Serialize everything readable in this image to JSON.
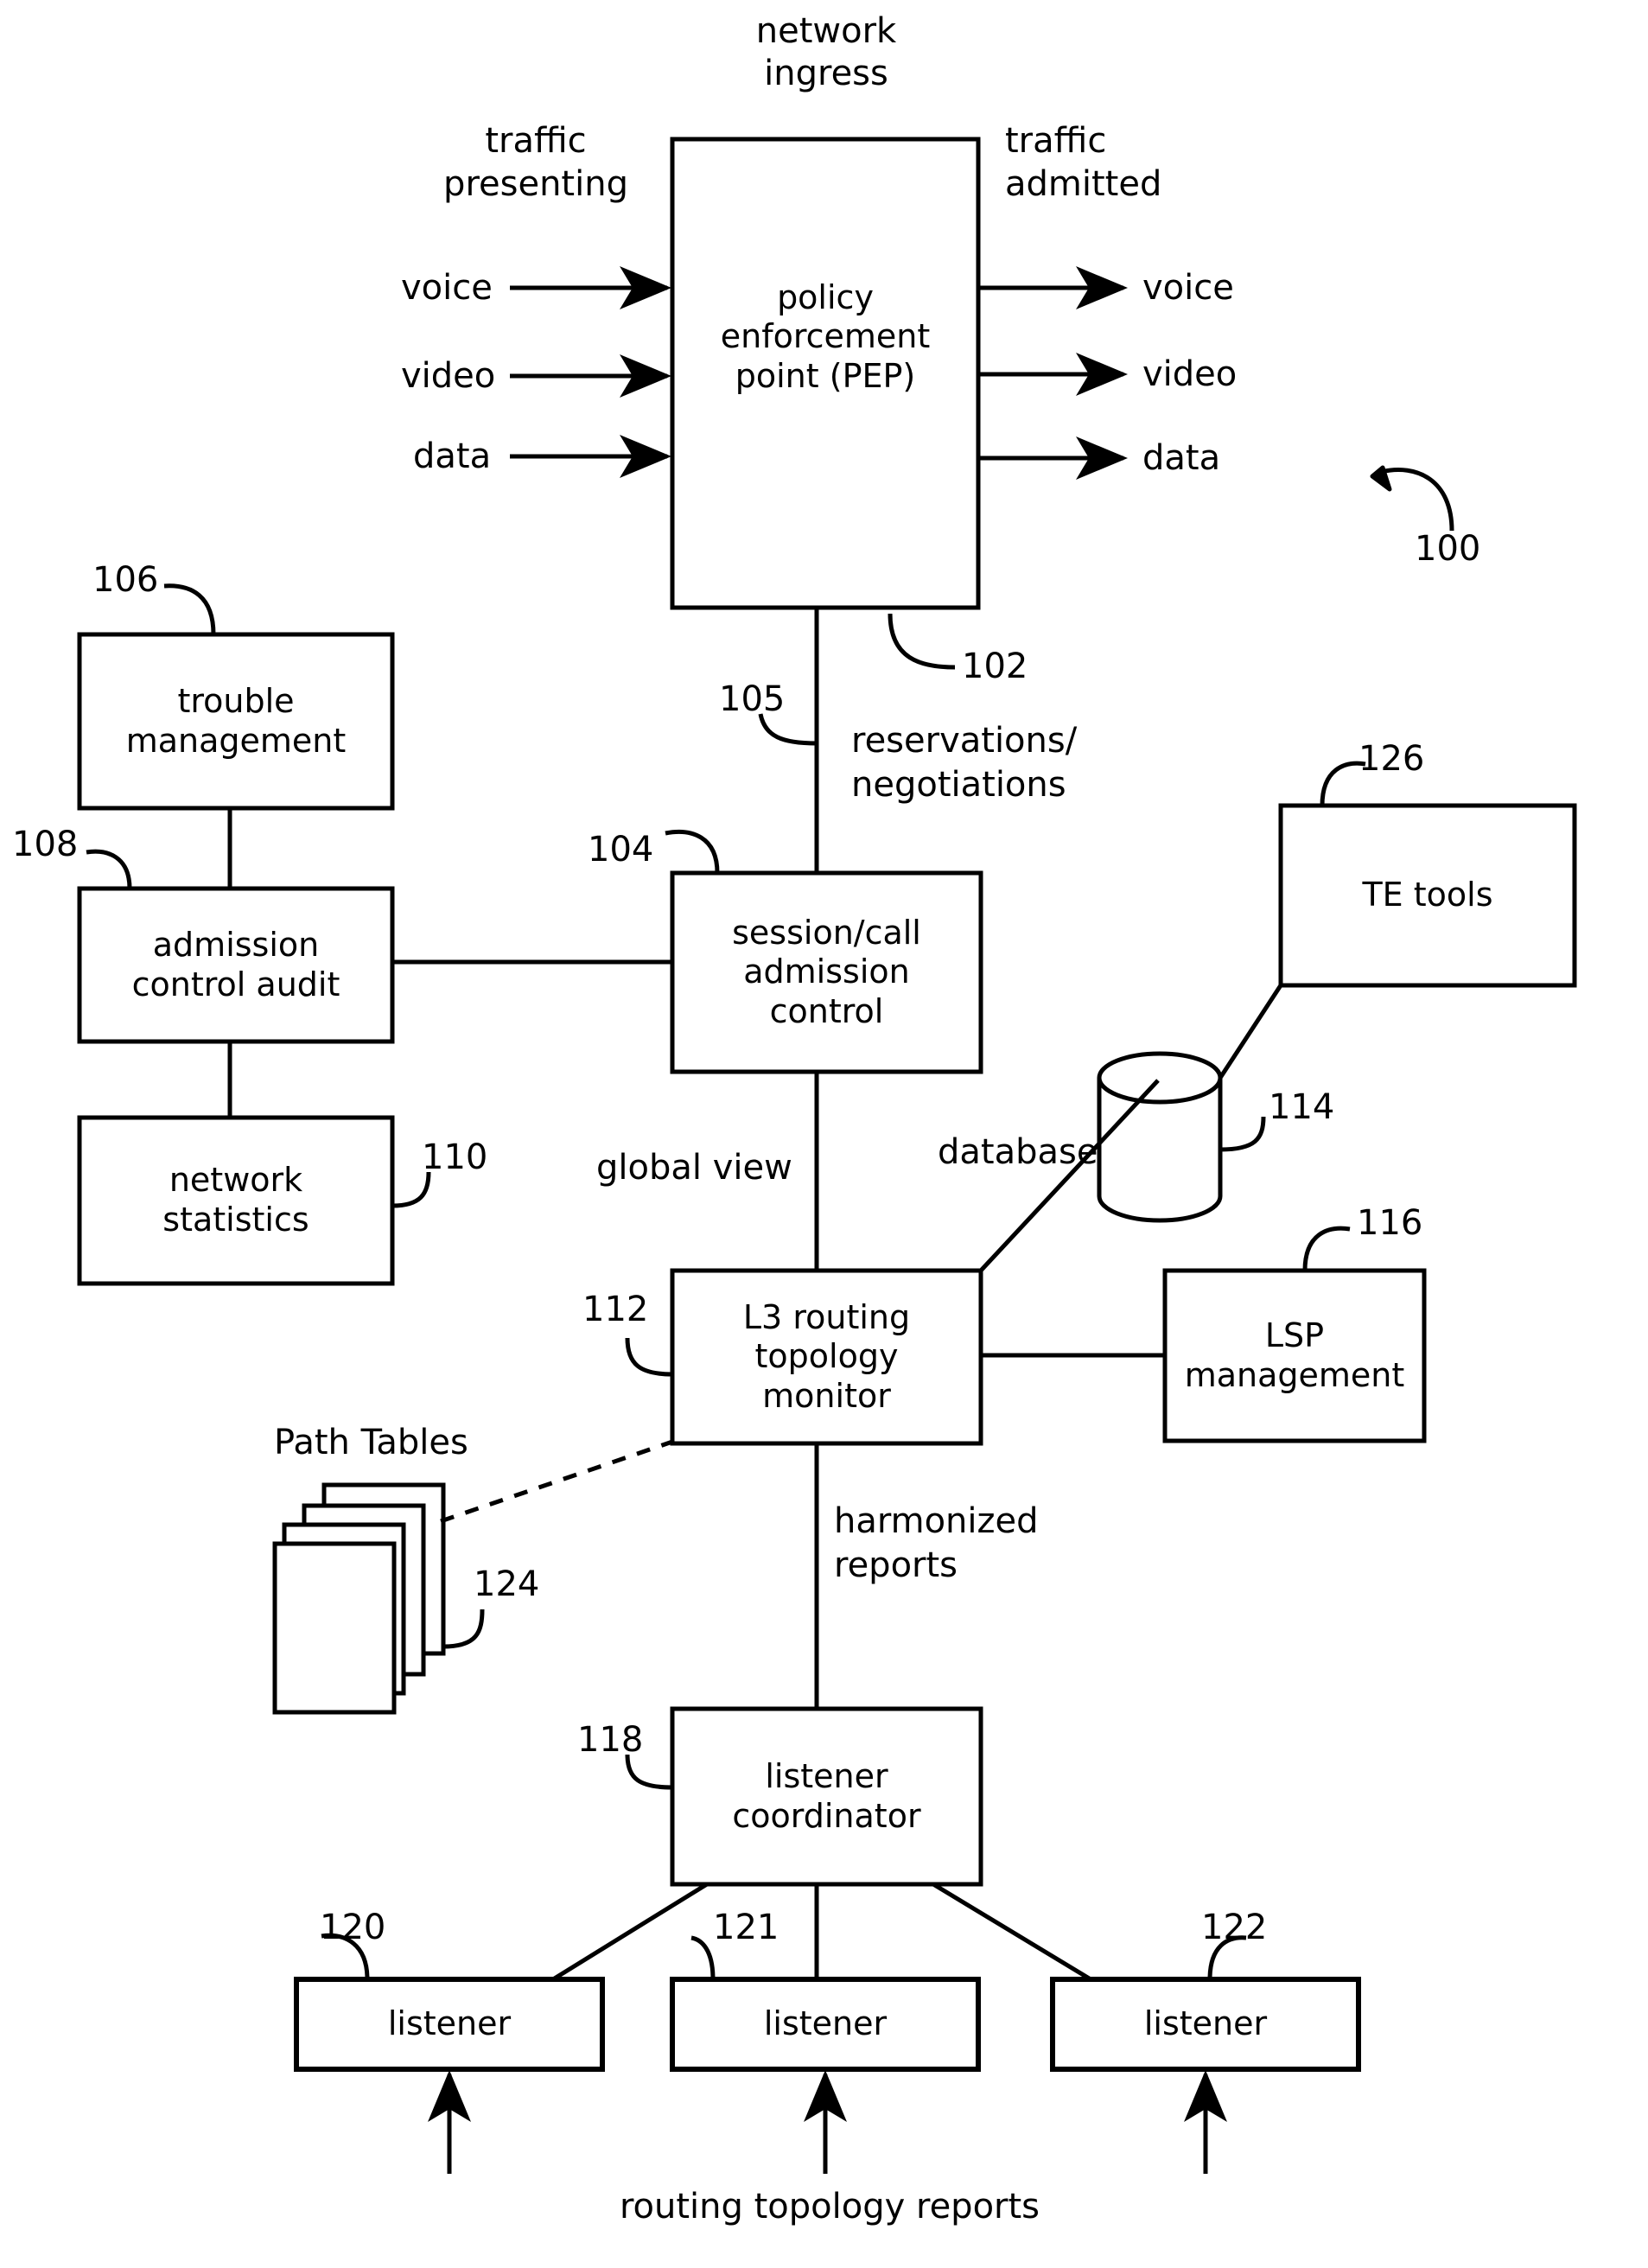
{
  "figure": {
    "reference_number": "100",
    "title_text": "network\ningress"
  },
  "labels": {
    "network_ingress_line1": "network",
    "network_ingress_line2": "ingress",
    "traffic_presenting_line1": "traffic",
    "traffic_presenting_line2": "presenting",
    "traffic_admitted_line1": "traffic",
    "traffic_admitted_line2": "admitted",
    "reservations_line1": "reservations/",
    "reservations_line2": "negotiations",
    "global_view": "global view",
    "database": "database",
    "path_tables": "Path Tables",
    "harmonized_line1": "harmonized",
    "harmonized_line2": "reports",
    "routing_topology_reports": "routing topology reports"
  },
  "inputs": [
    {
      "name": "voice",
      "label": "voice"
    },
    {
      "name": "video",
      "label": "video"
    },
    {
      "name": "data",
      "label": "data"
    }
  ],
  "outputs": [
    {
      "name": "voice",
      "label": "voice"
    },
    {
      "name": "video",
      "label": "video"
    },
    {
      "name": "data",
      "label": "data"
    }
  ],
  "boxes": {
    "pep": {
      "label": "policy\nenforcement\npoint (PEP)",
      "ref": "102"
    },
    "trouble_management": {
      "label": "trouble\nmanagement",
      "ref": "106"
    },
    "admission_control_audit": {
      "label": "admission\ncontrol audit",
      "ref": "108"
    },
    "network_statistics": {
      "label": "network\nstatistics",
      "ref": "110"
    },
    "session_call_admission_control": {
      "label": "session/call\nadmission\ncontrol",
      "ref": "104"
    },
    "l3_routing_topology_monitor": {
      "label": "L3 routing\ntopology\nmonitor",
      "ref": "112"
    },
    "te_tools": {
      "label": "TE tools",
      "ref": "126"
    },
    "lsp_management": {
      "label": "LSP\nmanagement",
      "ref": "116"
    },
    "listener_coordinator": {
      "label": "listener\ncoordinator",
      "ref": "118"
    },
    "database_cylinder": {
      "label": "database",
      "ref": "114"
    },
    "path_tables_stack": {
      "label": "Path Tables",
      "ref": "124"
    }
  },
  "listeners": [
    {
      "label": "listener",
      "ref": "120"
    },
    {
      "label": "listener",
      "ref": "121"
    },
    {
      "label": "listener",
      "ref": "122"
    }
  ],
  "connector_refs": {
    "pep_to_cac": "105"
  },
  "colors": {
    "stroke": "#000000",
    "background": "#ffffff"
  }
}
